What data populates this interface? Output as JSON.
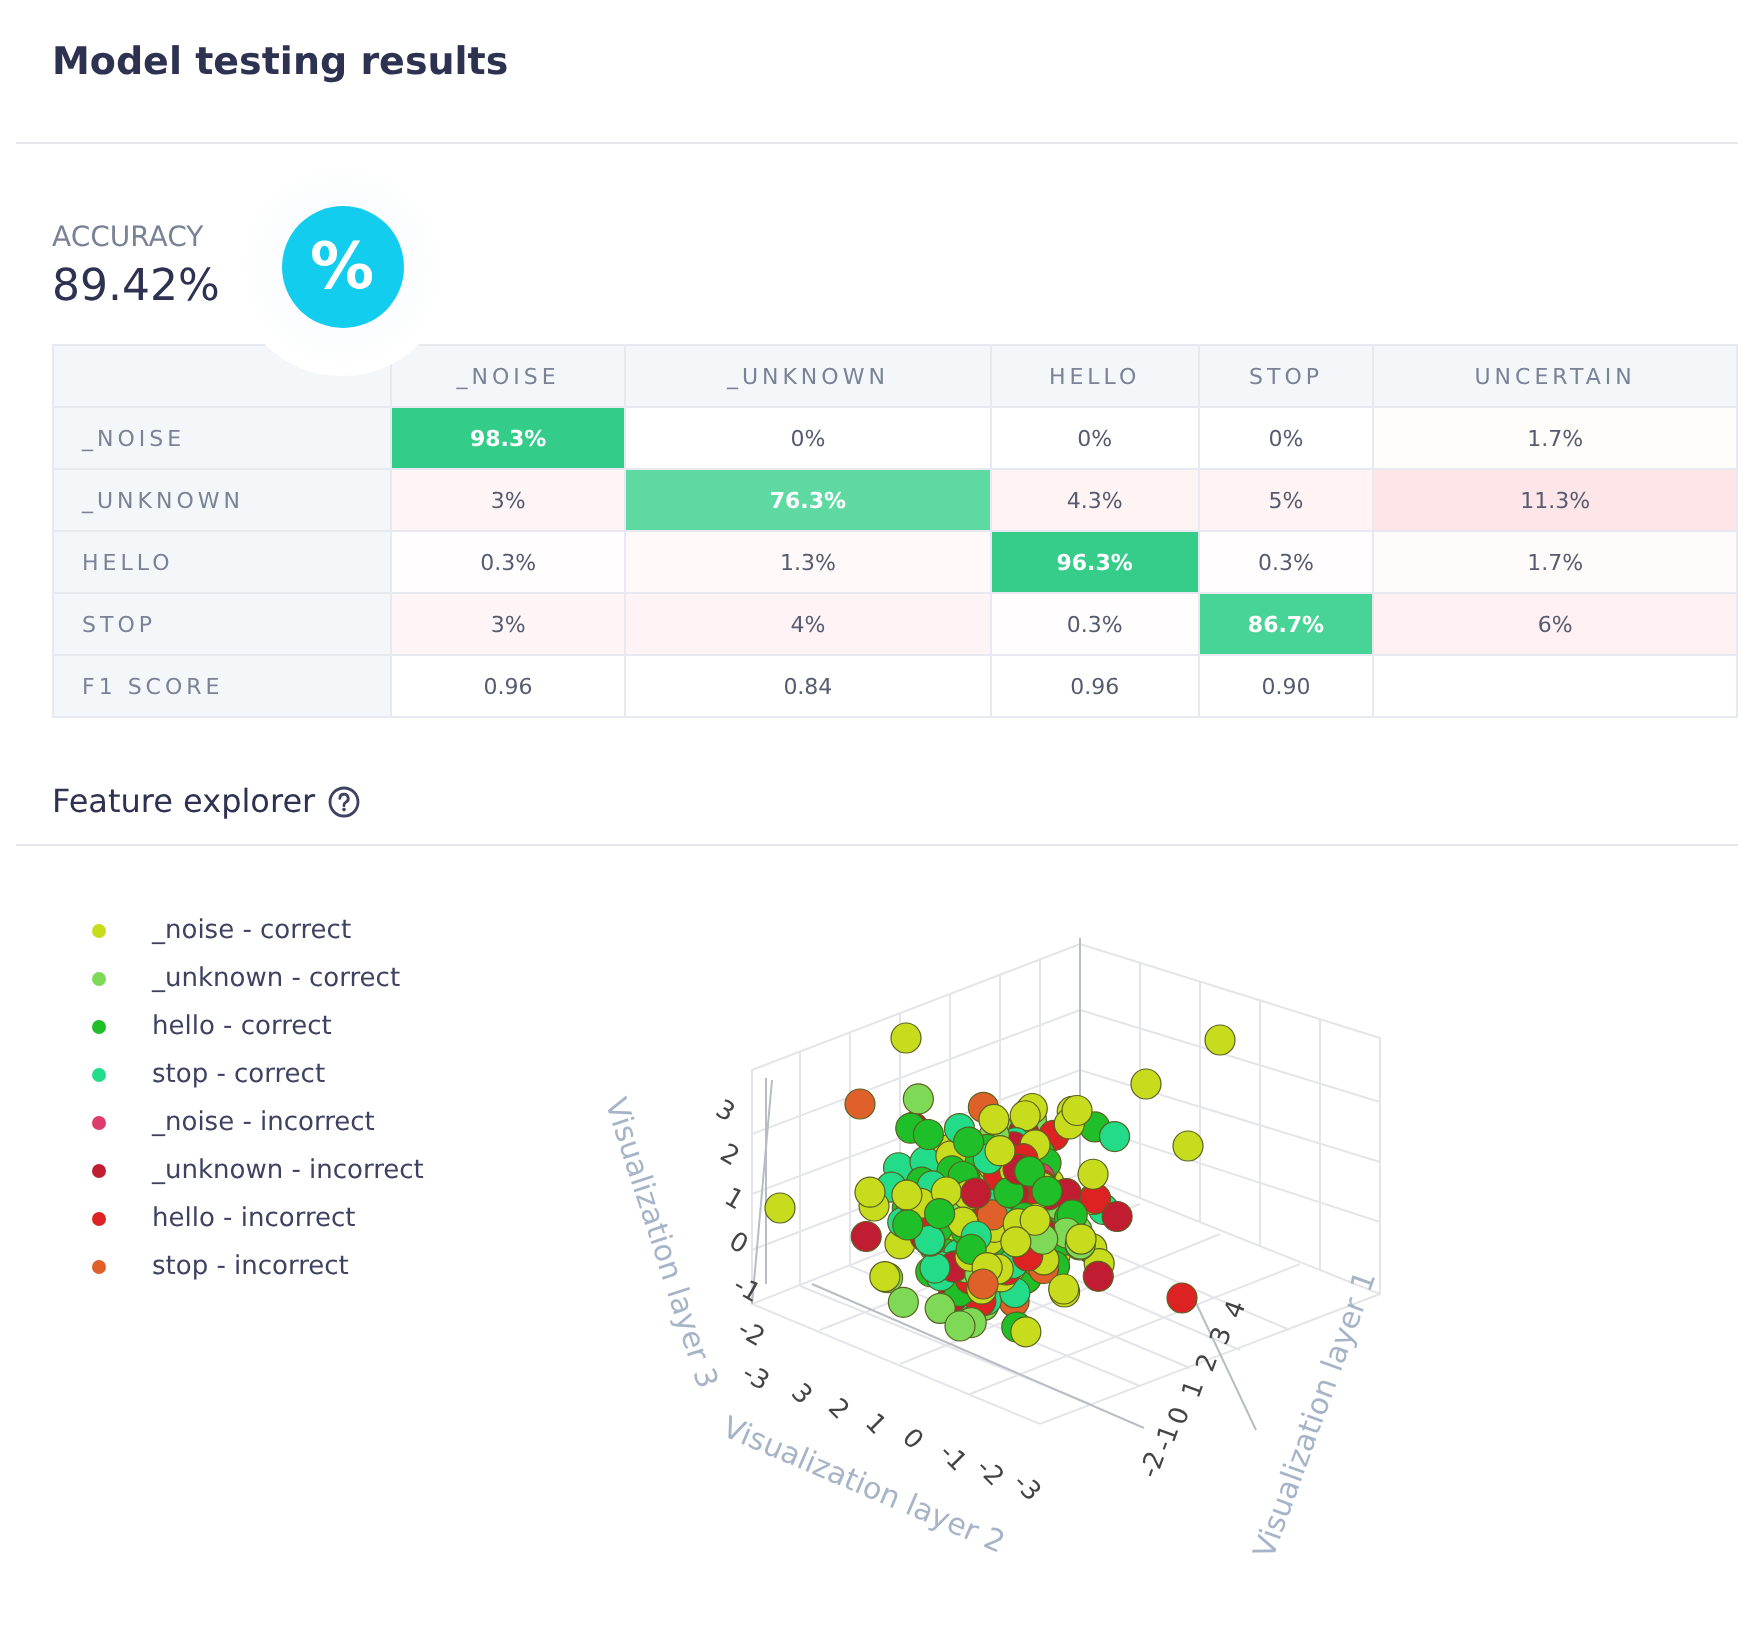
{
  "title": "Model testing results",
  "accuracy": {
    "label": "ACCURACY",
    "value": "89.42%",
    "icon_text": "%"
  },
  "table": {
    "columns": [
      "_NOISE",
      "_UNKNOWN",
      "HELLO",
      "STOP",
      "UNCERTAIN"
    ],
    "rows": [
      {
        "label": "_NOISE",
        "cells": [
          {
            "text": "98.3%",
            "color": "#33cc88"
          },
          {
            "text": "0%",
            "color": "#ffffff"
          },
          {
            "text": "0%",
            "color": "#ffffff"
          },
          {
            "text": "0%",
            "color": "#ffffff"
          },
          {
            "text": "1.7%",
            "color": "#fffcfa"
          }
        ]
      },
      {
        "label": "_UNKNOWN",
        "cells": [
          {
            "text": "3%",
            "color": "#fff5f6"
          },
          {
            "text": "76.3%",
            "color": "#5dd9a1"
          },
          {
            "text": "4.3%",
            "color": "#fff3f4"
          },
          {
            "text": "5%",
            "color": "#fff3f4"
          },
          {
            "text": "11.3%",
            "color": "#fde5e8"
          }
        ]
      },
      {
        "label": "HELLO",
        "cells": [
          {
            "text": "0.3%",
            "color": "#fffdfd"
          },
          {
            "text": "1.3%",
            "color": "#fff9fa"
          },
          {
            "text": "96.3%",
            "color": "#35cd89"
          },
          {
            "text": "0.3%",
            "color": "#fffdfd"
          },
          {
            "text": "1.7%",
            "color": "#fffbfa"
          }
        ]
      },
      {
        "label": "STOP",
        "cells": [
          {
            "text": "3%",
            "color": "#fff5f6"
          },
          {
            "text": "4%",
            "color": "#fff3f5"
          },
          {
            "text": "0.3%",
            "color": "#fffdfd"
          },
          {
            "text": "86.7%",
            "color": "#48d496"
          },
          {
            "text": "6%",
            "color": "#fff0f2"
          }
        ]
      },
      {
        "label": "F1 SCORE",
        "cells": [
          {
            "text": "0.96",
            "color": "#ffffff"
          },
          {
            "text": "0.84",
            "color": "#ffffff"
          },
          {
            "text": "0.96",
            "color": "#ffffff"
          },
          {
            "text": "0.90",
            "color": "#ffffff"
          }
        ]
      }
    ]
  },
  "feature_explorer": {
    "title": "Feature explorer",
    "legend": [
      {
        "label": "_noise - correct",
        "color": "#c8dc1e"
      },
      {
        "label": "_unknown - correct",
        "color": "#7ed957"
      },
      {
        "label": "hello - correct",
        "color": "#1fbf2a"
      },
      {
        "label": "stop - correct",
        "color": "#22dc8a"
      },
      {
        "label": "_noise - incorrect",
        "color": "#dc3c6a"
      },
      {
        "label": "_unknown - incorrect",
        "color": "#c01c32"
      },
      {
        "label": "hello - incorrect",
        "color": "#dc2222"
      },
      {
        "label": "stop - incorrect",
        "color": "#e0602a"
      }
    ],
    "plot": {
      "axis_1": {
        "title": "Visualization layer 1",
        "ticks": [
          "4",
          "3",
          "2",
          "1",
          "0",
          "-1",
          "-2"
        ]
      },
      "axis_2": {
        "title": "Visualization layer 2",
        "ticks": [
          "3",
          "2",
          "1",
          "0",
          "-1",
          "-2",
          "-3"
        ]
      },
      "axis_3": {
        "title": "Visualization layer 3",
        "ticks": [
          "3",
          "2",
          "1",
          "0",
          "-1",
          "-2",
          "-3"
        ]
      }
    }
  }
}
